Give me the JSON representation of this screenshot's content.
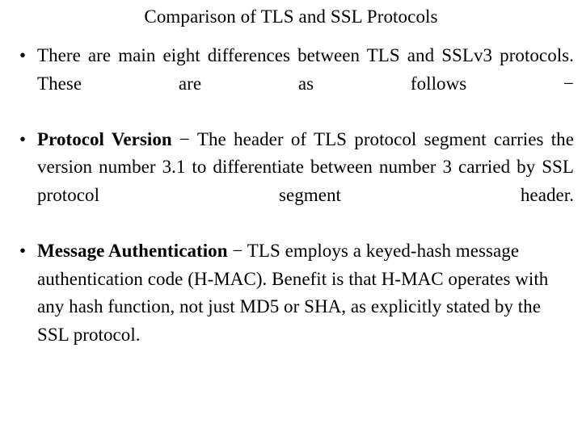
{
  "slide": {
    "title": "Comparison of TLS and SSL Protocols",
    "background_color": "#ffffff",
    "text_color": "#000000",
    "bullet_glyph": "•",
    "dash_glyph": "−"
  },
  "bullets": [
    {
      "marker": "•",
      "lead": "",
      "dash": "",
      "text": "There are main eight differences between TLS and SSLv3 protocols. These are as follows −",
      "full_text": "There are main eight differences between TLS and SSLv3 protocols. These are as follows −",
      "lines": [
        "There are main eight differences between TLS and",
        "SSLv3 protocols. These are as follows −"
      ]
    },
    {
      "marker": "•",
      "lead": "Protocol Version",
      "dash": " − ",
      "text": "The header of TLS protocol segment carries the version number 3.1 to differentiate between number 3 carried by SSL protocol segment header.",
      "full_text": "Protocol Version − The header of TLS protocol segment carries the version number 3.1 to differentiate between number 3 carried by SSL protocol segment header.",
      "lines": [
        "Protocol Version − The header of TLS protocol segment",
        "carries the version number 3.1 to differentiate between",
        "number 3 carried by SSL protocol segment header."
      ]
    },
    {
      "marker": "•",
      "lead": "Message Authentication",
      "dash": " − ",
      "text": "TLS employs a keyed-hash message authentication code (H-MAC). Benefit is that H-MAC operates with any hash function, not just MD5 or SHA, as explicitly stated by the SSL protocol.",
      "full_text": "Message Authentication − TLS employs a keyed-hash message authentication code (H-MAC). Benefit is that H-MAC operates with any hash function, not just MD5 or SHA, as explicitly stated by the SSL protocol.",
      "lines": [
        "Message Authentication − TLS employs a keyed-hash",
        "message authentication code (H-MAC). Benefit is that H-",
        "MAC operates with any hash function, not just MD5 or",
        "SHA, as explicitly stated by the SSL protocol."
      ]
    }
  ]
}
